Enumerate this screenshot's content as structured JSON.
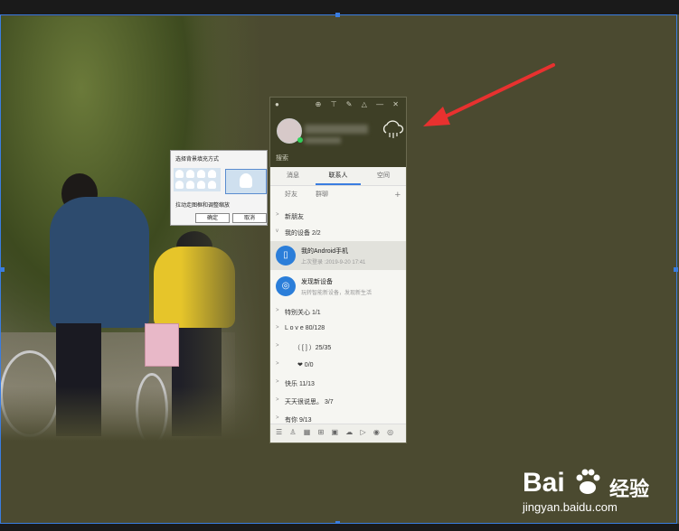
{
  "popup": {
    "title": "选择背景填充方式",
    "hint": "拉动走图框和调整缩放",
    "ok": "确定",
    "cancel": "取消"
  },
  "qq": {
    "search_placeholder": "搜索",
    "tabs": [
      "消息",
      "联系人",
      "空间"
    ],
    "subtabs": [
      "好友",
      "群聊"
    ],
    "groups": [
      {
        "label": "新朋友",
        "expanded": false
      },
      {
        "label": "我的设备 2/2",
        "expanded": true
      }
    ],
    "devices": [
      {
        "name": "我的Android手机",
        "sub": "上次登录 :2019-9-20 17:41",
        "icon": "phone-icon"
      },
      {
        "name": "发现新设备",
        "sub": "玩转智能新设备，发现新生活",
        "icon": "wifi-icon"
      }
    ],
    "more_groups": [
      "特别关心 1/1",
      "L o v e  80/128",
      "（ [ ] ）25/35",
      "❤ 0/0",
      "快乐 11/13",
      "天天很说思。 3/7",
      "有你 9/13"
    ]
  },
  "watermark": {
    "brand": "Bai",
    "cn": "经验",
    "url": "jingyan.baidu.com"
  },
  "colors": {
    "background": "#4b4a30",
    "selection": "#3a7de0",
    "arrow": "#e8312f"
  }
}
